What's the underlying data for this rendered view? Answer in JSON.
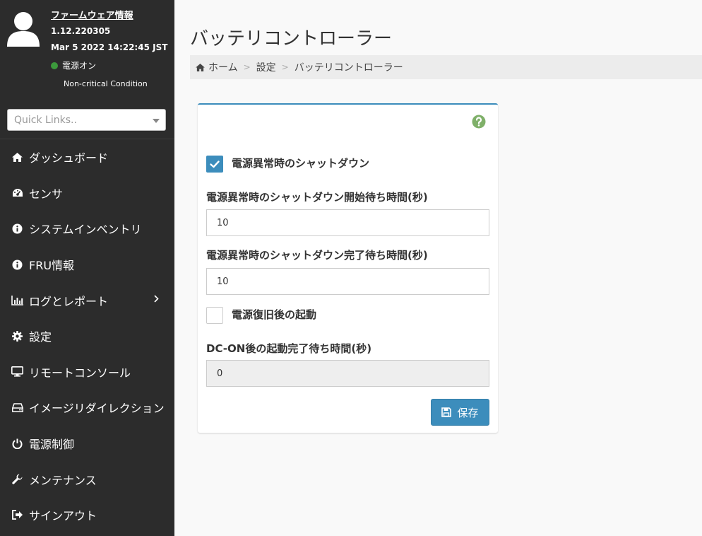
{
  "profile": {
    "firmware_title": "ファームウェア情報",
    "firmware_version": "1.12.220305",
    "firmware_date": "Mar 5 2022 14:22:45 JST",
    "power_status": "電源オン",
    "condition": "Non-critical Condition",
    "power_color": "#3c9a3c"
  },
  "quicklinks": {
    "placeholder": "Quick Links.."
  },
  "nav": [
    {
      "label": "ダッシュボード",
      "icon": "home-icon"
    },
    {
      "label": "センサ",
      "icon": "dashboard-gauge-icon"
    },
    {
      "label": "システムインベントリ",
      "icon": "info-icon"
    },
    {
      "label": "FRU情報",
      "icon": "info-icon"
    },
    {
      "label": "ログとレポート",
      "icon": "bar-chart-icon"
    },
    {
      "label": "設定",
      "icon": "gear-icon"
    },
    {
      "label": "リモートコンソール",
      "icon": "monitor-icon"
    },
    {
      "label": "イメージリダイレクション",
      "icon": "drive-icon"
    },
    {
      "label": "電源制御",
      "icon": "power-icon"
    },
    {
      "label": "メンテナンス",
      "icon": "wrench-icon"
    },
    {
      "label": "サインアウト",
      "icon": "sign-out-icon"
    }
  ],
  "page": {
    "title": "バッテリコントローラー",
    "breadcrumb": [
      "ホーム",
      "設定",
      "バッテリコントローラー"
    ]
  },
  "form": {
    "shutdown_checkbox_label": "電源異常時のシャットダウン",
    "shutdown_checked": true,
    "shutdown_start_label": "電源異常時のシャットダウン開始待ち時間(秒)",
    "shutdown_start_value": "10",
    "shutdown_complete_label": "電源異常時のシャットダウン完了待ち時間(秒)",
    "shutdown_complete_value": "10",
    "restart_checkbox_label": "電源復旧後の起動",
    "restart_checked": false,
    "dcon_label": "DC-ON後の起動完了待ち時間(秒)",
    "dcon_value": "0",
    "save_label": "保存"
  },
  "colors": {
    "accent": "#3c8dbc",
    "sidebar_bg": "#2c2c2c",
    "help_icon": "#7fb069"
  }
}
